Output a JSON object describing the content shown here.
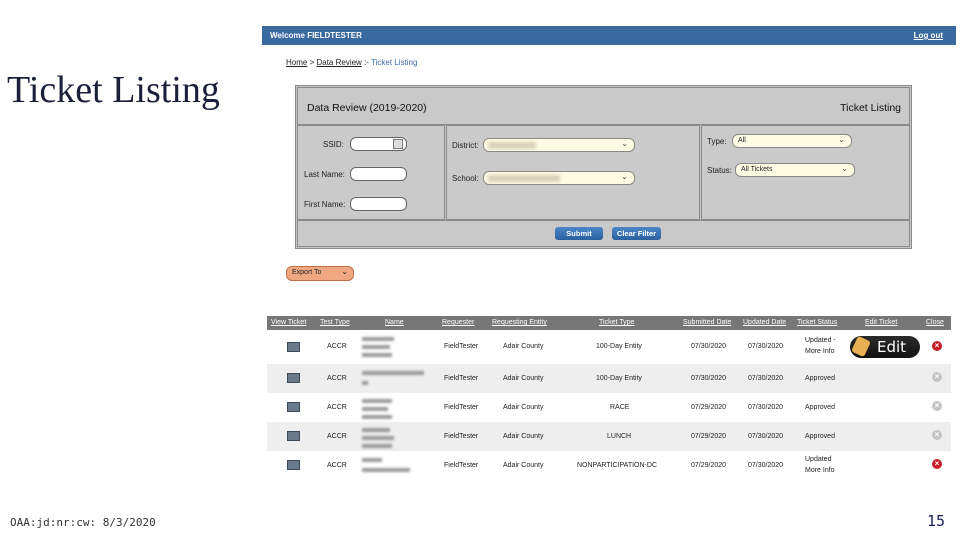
{
  "slide": {
    "title": "Ticket Listing",
    "footer": "OAA:jd:nr:cw: 8/3/2020",
    "page_number": "15"
  },
  "app": {
    "welcome": "Welcome FIELDTESTER",
    "logout": "Log out",
    "breadcrumb": {
      "home": "Home",
      "sep": ">",
      "data_review": "Data Review",
      "sep2": ":-",
      "current": "Ticket Listing"
    },
    "panel": {
      "title_left": "Data Review (2019-2020)",
      "title_right": "Ticket Listing",
      "ssid_label": "SSID:",
      "last_name_label": "Last Name:",
      "first_name_label": "First Name:",
      "district_label": "District:",
      "school_label": "School:",
      "type_label": "Type:",
      "type_value": "All",
      "status_label": "Status:",
      "status_value": "All Tickets",
      "submit": "Submit",
      "clear_filter": "Clear Filter"
    },
    "export": "Export To",
    "table": {
      "headers": [
        "View Ticket",
        "Test Type",
        "Name",
        "Requester",
        "Requesting Entity",
        "Ticket Type",
        "Submitted Date",
        "Updated Date",
        "Ticket Status",
        "Edit Ticket",
        "Close"
      ],
      "rows": [
        {
          "test_type": "ACCR",
          "requester": "FieldTester",
          "entity": "Adair County",
          "ticket_type": "100-Day Entity",
          "submitted": "07/30/2020",
          "updated": "07/30/2020",
          "status_line1": "Updated -",
          "status_line2": "More Info",
          "edit_label": "Edit",
          "close_active": true
        },
        {
          "test_type": "ACCR",
          "requester": "FieldTester",
          "entity": "Adair County",
          "ticket_type": "100-Day Entity",
          "submitted": "07/30/2020",
          "updated": "07/30/2020",
          "status_line1": "Approved",
          "status_line2": "",
          "edit_label": "",
          "close_active": false
        },
        {
          "test_type": "ACCR",
          "requester": "FieldTester",
          "entity": "Adair County",
          "ticket_type": "RACE",
          "submitted": "07/29/2020",
          "updated": "07/30/2020",
          "status_line1": "Approved",
          "status_line2": "",
          "edit_label": "",
          "close_active": false
        },
        {
          "test_type": "ACCR",
          "requester": "FieldTester",
          "entity": "Adair County",
          "ticket_type": "LUNCH",
          "submitted": "07/29/2020",
          "updated": "07/30/2020",
          "status_line1": "Approved",
          "status_line2": "",
          "edit_label": "",
          "close_active": false
        },
        {
          "test_type": "ACCR",
          "requester": "FieldTester",
          "entity": "Adair County",
          "ticket_type": "NONPARTICIPATION-DC",
          "submitted": "07/29/2020",
          "updated": "07/30/2020",
          "status_line1": "Updated",
          "status_line2": "More Info",
          "edit_label": "",
          "close_active": true
        }
      ]
    },
    "colors": {
      "topbar": "#3a69a0",
      "panel": "#c5c5c5",
      "close_active": "#c81e28",
      "close_inactive": "#c4c4c4",
      "export": "#f0a882"
    }
  }
}
